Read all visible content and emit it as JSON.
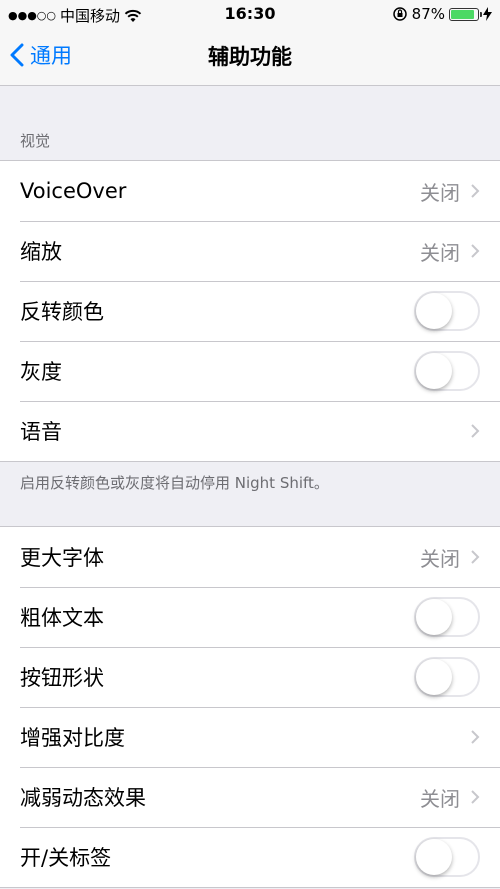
{
  "status_bar": {
    "signal_dots": "●●●○○",
    "carrier": "中国移动",
    "time": "16:30",
    "battery_percent": "87%",
    "battery_level": 0.87
  },
  "nav": {
    "back_label": "通用",
    "title": "辅助功能"
  },
  "section1": {
    "header": "视觉",
    "rows": [
      {
        "label": "VoiceOver",
        "value": "关闭"
      },
      {
        "label": "缩放",
        "value": "关闭"
      },
      {
        "label": "反转颜色"
      },
      {
        "label": "灰度"
      },
      {
        "label": "语音"
      }
    ],
    "footer": "启用反转颜色或灰度将自动停用 Night Shift。"
  },
  "section2": {
    "rows": [
      {
        "label": "更大字体",
        "value": "关闭"
      },
      {
        "label": "粗体文本"
      },
      {
        "label": "按钮形状"
      },
      {
        "label": "增强对比度"
      },
      {
        "label": "减弱动态效果",
        "value": "关闭"
      },
      {
        "label": "开/关标签"
      }
    ]
  },
  "colors": {
    "accent": "#007aff",
    "battery": "#4cd964",
    "background": "#efeff4"
  }
}
